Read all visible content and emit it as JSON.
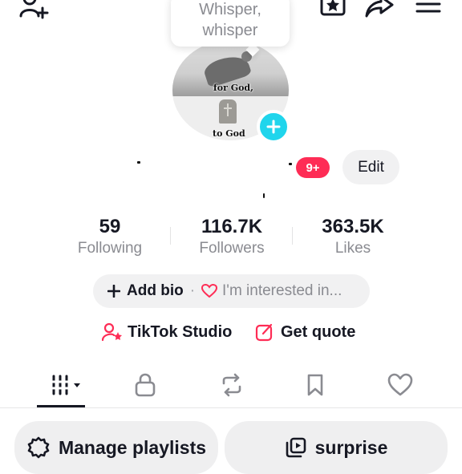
{
  "header": {
    "add_friend_icon": "person-plus-icon",
    "favorites_icon": "star-square-icon",
    "share_icon": "share-arrow-icon",
    "menu_icon": "hamburger-menu-icon"
  },
  "tooltip": {
    "line1": "Whisper,",
    "line2": "whisper"
  },
  "avatar": {
    "caption_top": "for God,",
    "caption_bottom": "to God"
  },
  "profile": {
    "notifications_badge": "9+",
    "edit_label": "Edit"
  },
  "stats": [
    {
      "value": "59",
      "label": "Following"
    },
    {
      "value": "116.7K",
      "label": "Followers"
    },
    {
      "value": "363.5K",
      "label": "Likes"
    }
  ],
  "bio": {
    "add_label": "Add bio",
    "separator": "·",
    "interest_label": "I'm interested in..."
  },
  "links": {
    "studio_label": "TikTok Studio",
    "quote_label": "Get quote"
  },
  "tabs": [
    {
      "name": "videos",
      "icon": "grid-bars-icon",
      "active": true
    },
    {
      "name": "private",
      "icon": "lock-icon",
      "active": false
    },
    {
      "name": "reposts",
      "icon": "repost-icon",
      "active": false
    },
    {
      "name": "favorites",
      "icon": "bookmark-icon",
      "active": false
    },
    {
      "name": "liked",
      "icon": "heart-icon",
      "active": false
    }
  ],
  "actions": {
    "playlists_label": "Manage playlists",
    "surprise_label": "surprise"
  },
  "colors": {
    "accent_red": "#fe2c55",
    "accent_cyan": "#20d5ec",
    "text_primary": "#161823",
    "text_secondary": "#8a8b91"
  }
}
